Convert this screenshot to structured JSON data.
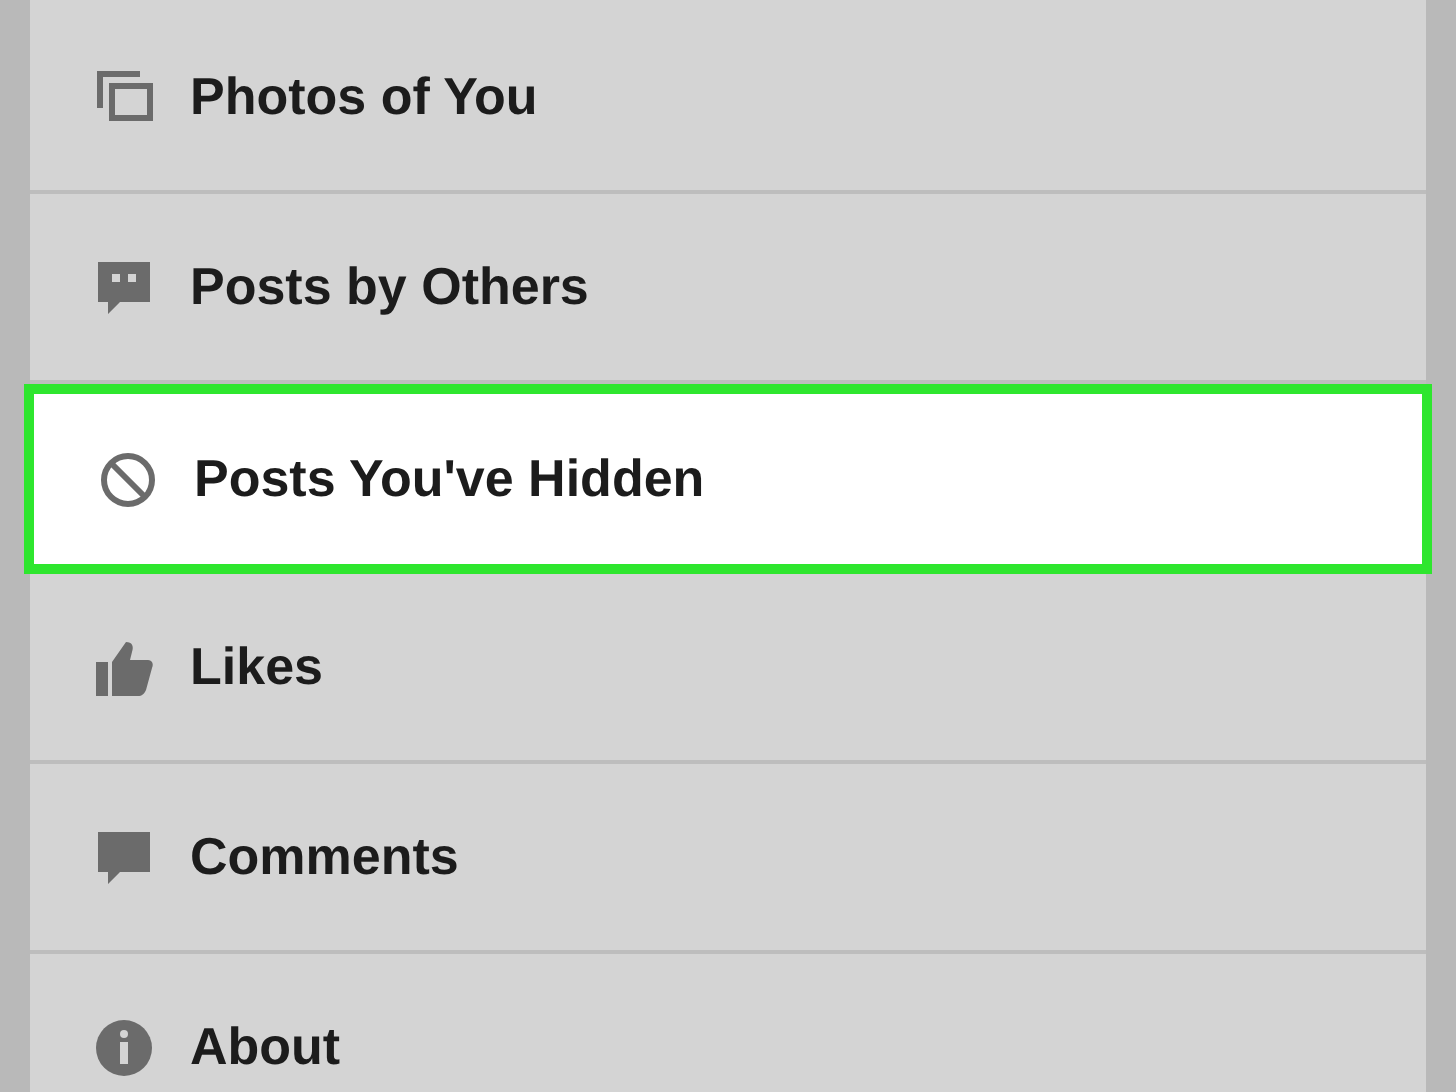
{
  "menu": {
    "items": [
      {
        "label": "Photos of You",
        "selected": false
      },
      {
        "label": "Posts by Others",
        "selected": false
      },
      {
        "label": "Posts You've Hidden",
        "selected": true
      },
      {
        "label": "Likes",
        "selected": false
      },
      {
        "label": "Comments",
        "selected": false
      },
      {
        "label": "About",
        "selected": false
      }
    ]
  }
}
